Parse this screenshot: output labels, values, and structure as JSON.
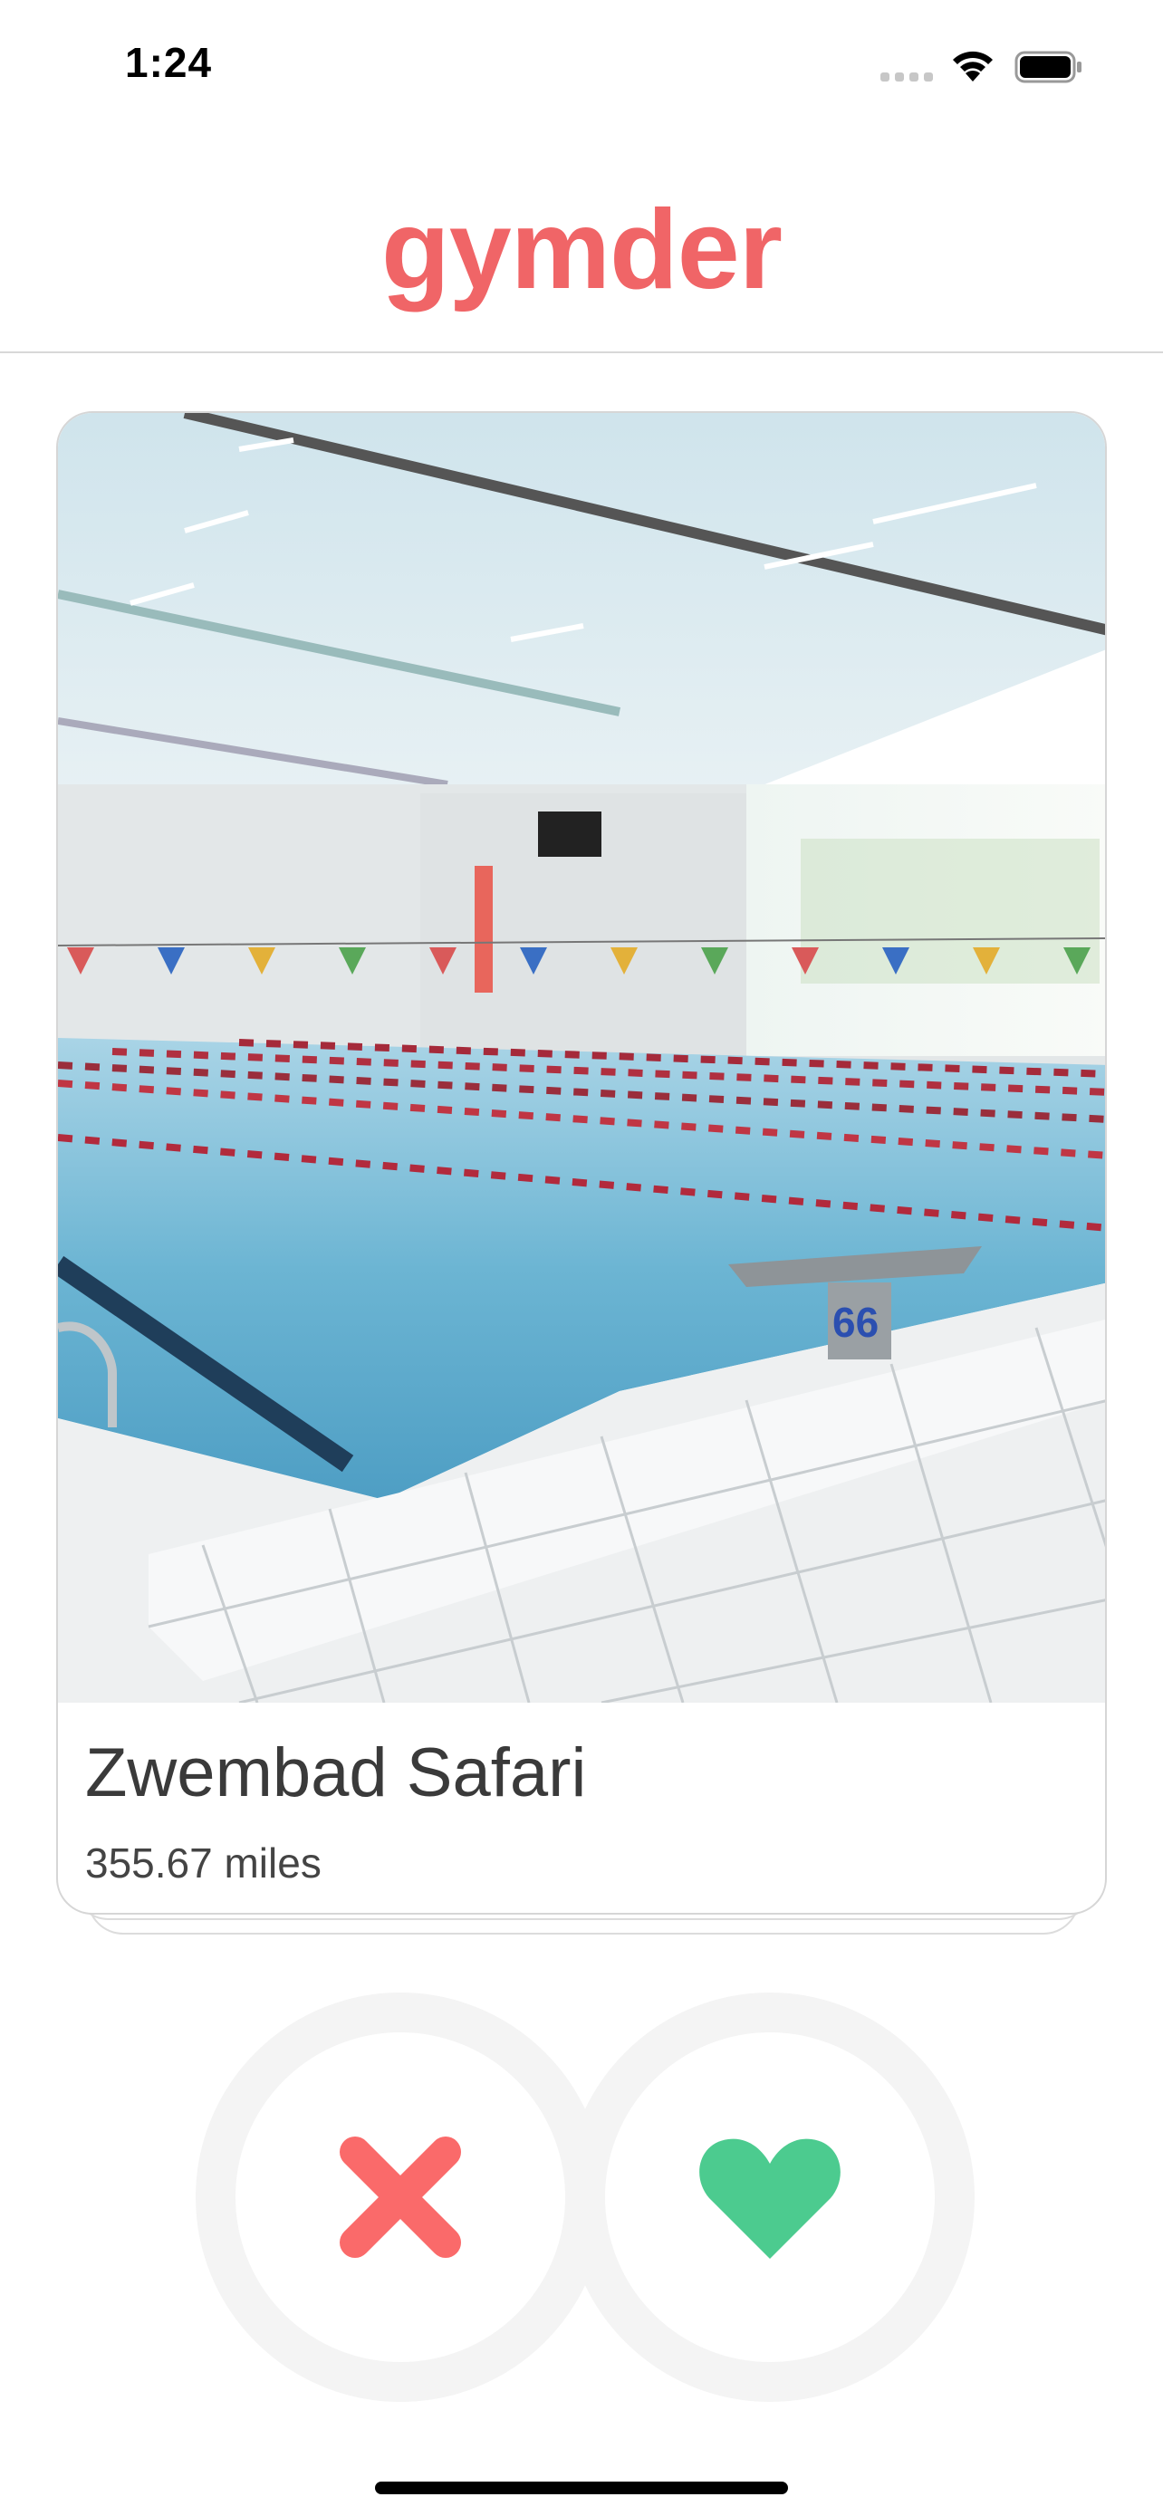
{
  "status_bar": {
    "time": "1:24",
    "icons": [
      "cellular-signal-icon",
      "wifi-icon",
      "battery-icon"
    ]
  },
  "header": {
    "title": "gymder",
    "title_color": "#f06567"
  },
  "card": {
    "image": "indoor-swimming-pool-photo",
    "name": "Zwembad Safari",
    "distance": "355.67 miles"
  },
  "actions": {
    "nope_icon": "close-icon",
    "nope_color": "#fa6a6a",
    "like_icon": "heart-icon",
    "like_color": "#4ccb8f"
  },
  "colors": {
    "brand": "#f06567",
    "divider": "#d8d8d8",
    "button_ring": "#f4f4f4"
  }
}
